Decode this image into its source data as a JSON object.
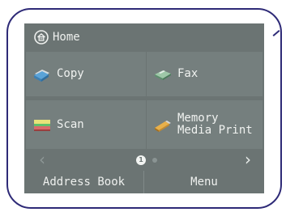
{
  "header": {
    "title": "Home",
    "icon": "home-icon"
  },
  "tiles": [
    {
      "label": "Copy",
      "icon": "copy-icon"
    },
    {
      "label": "Fax",
      "icon": "fax-icon"
    },
    {
      "label": "Scan",
      "icon": "scan-icon"
    },
    {
      "label": "Memory\nMedia Print",
      "icon": "memory-card-icon"
    }
  ],
  "pager": {
    "prev": "‹",
    "next": "›",
    "current_page": "1",
    "total_pages": 2
  },
  "bottom": {
    "address_book": "Address Book",
    "menu": "Menu"
  },
  "colors": {
    "screen_bg": "#6b7473",
    "tile_bg": "#757f7e",
    "frame": "#2e2a77",
    "text": "#eef0ee"
  }
}
